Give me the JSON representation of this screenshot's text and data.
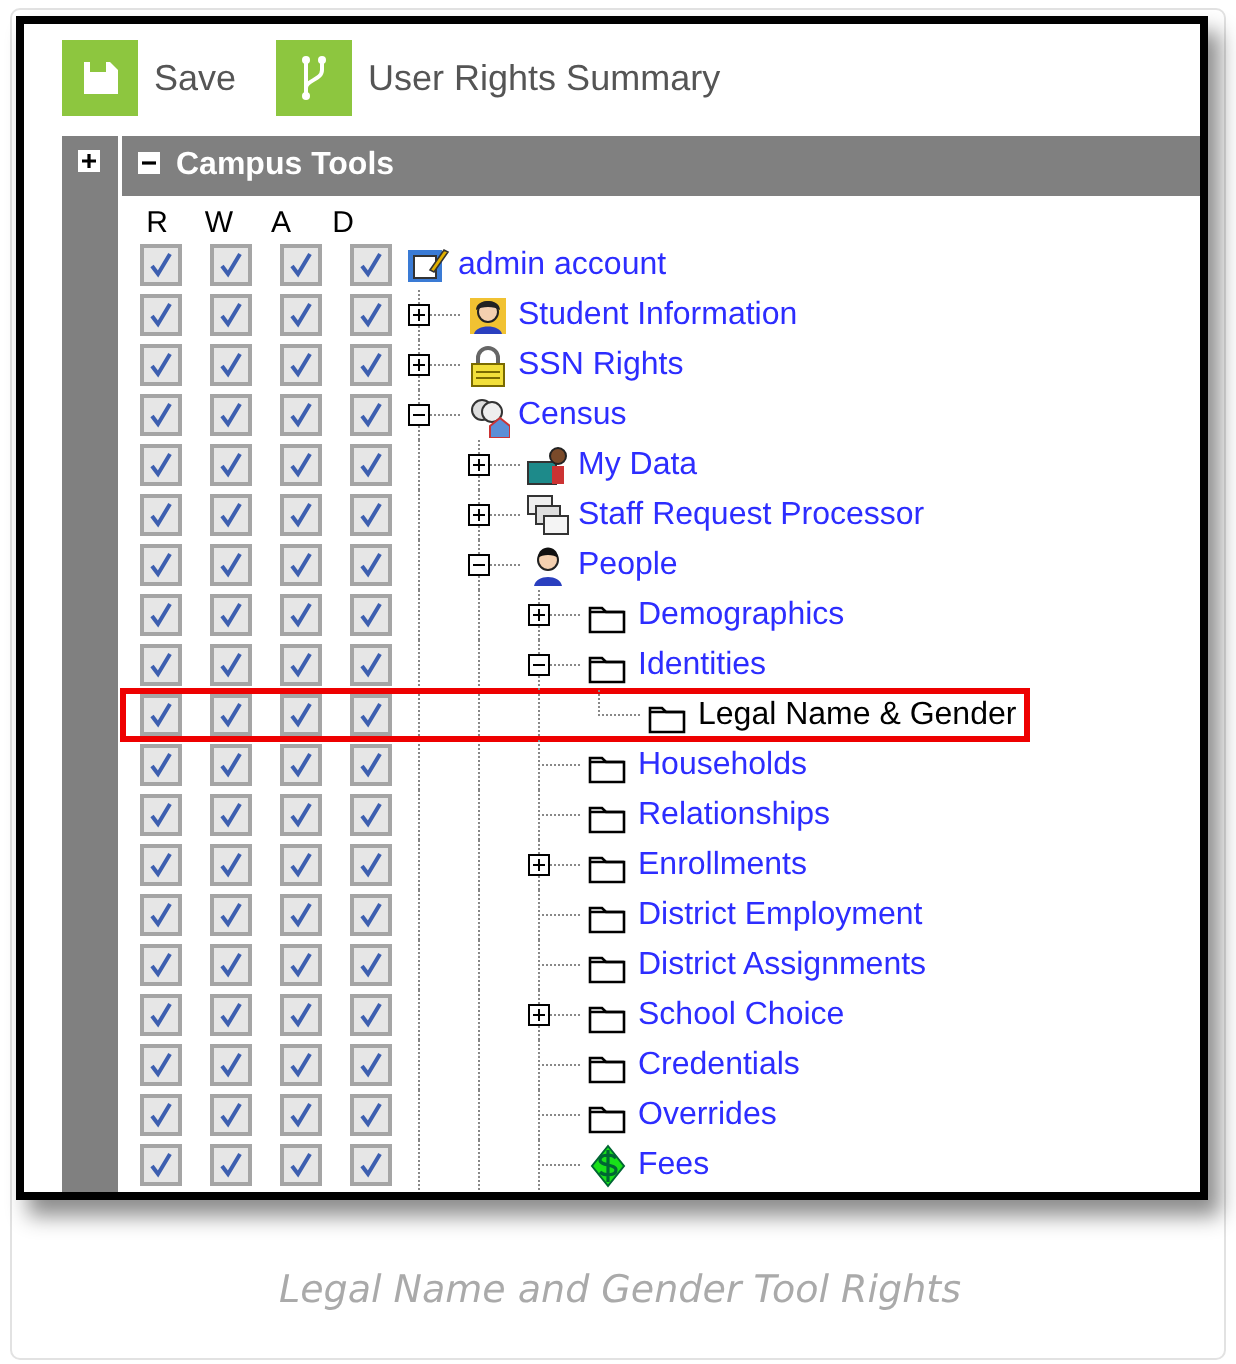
{
  "toolbar": {
    "buttons": [
      {
        "kind": "save",
        "label": "Save"
      },
      {
        "kind": "summary",
        "label": "User Rights Summary"
      }
    ]
  },
  "panel": {
    "title": "Campus Tools",
    "columns": [
      "R",
      "W",
      "A",
      "D"
    ],
    "tree": [
      {
        "label": "admin account",
        "kind": "account",
        "rights": [
          true,
          true,
          true,
          true
        ],
        "selected": false,
        "children": [
          {
            "label": "Student Information",
            "kind": "student",
            "expanded": false,
            "rights": [
              true,
              true,
              true,
              true
            ],
            "selected": false
          },
          {
            "label": "SSN Rights",
            "kind": "lock",
            "expanded": false,
            "rights": [
              true,
              true,
              true,
              true
            ],
            "selected": false
          },
          {
            "label": "Census",
            "kind": "census",
            "expanded": true,
            "rights": [
              true,
              true,
              true,
              true
            ],
            "selected": false,
            "children": [
              {
                "label": "My Data",
                "kind": "mydata",
                "expanded": false,
                "rights": [
                  true,
                  true,
                  true,
                  true
                ],
                "selected": false
              },
              {
                "label": "Staff Request Processor",
                "kind": "staff",
                "expanded": false,
                "rights": [
                  true,
                  true,
                  true,
                  true
                ],
                "selected": false
              },
              {
                "label": "People",
                "kind": "person",
                "expanded": true,
                "rights": [
                  true,
                  true,
                  true,
                  true
                ],
                "selected": false,
                "children": [
                  {
                    "label": "Demographics",
                    "kind": "folder",
                    "expanded": false,
                    "rights": [
                      true,
                      true,
                      true,
                      true
                    ],
                    "selected": false
                  },
                  {
                    "label": "Identities",
                    "kind": "folder",
                    "expanded": true,
                    "rights": [
                      true,
                      true,
                      true,
                      true
                    ],
                    "selected": false,
                    "children": [
                      {
                        "label": "Legal Name & Gender",
                        "kind": "folder",
                        "rights": [
                          true,
                          true,
                          true,
                          true
                        ],
                        "selected": true
                      }
                    ]
                  },
                  {
                    "label": "Households",
                    "kind": "folder",
                    "rights": [
                      true,
                      true,
                      true,
                      true
                    ],
                    "selected": false
                  },
                  {
                    "label": "Relationships",
                    "kind": "folder",
                    "rights": [
                      true,
                      true,
                      true,
                      true
                    ],
                    "selected": false
                  },
                  {
                    "label": "Enrollments",
                    "kind": "folder",
                    "expanded": false,
                    "rights": [
                      true,
                      true,
                      true,
                      true
                    ],
                    "selected": false
                  },
                  {
                    "label": "District Employment",
                    "kind": "folder",
                    "rights": [
                      true,
                      true,
                      true,
                      true
                    ],
                    "selected": false
                  },
                  {
                    "label": "District Assignments",
                    "kind": "folder",
                    "rights": [
                      true,
                      true,
                      true,
                      true
                    ],
                    "selected": false
                  },
                  {
                    "label": "School Choice",
                    "kind": "folder",
                    "expanded": false,
                    "rights": [
                      true,
                      true,
                      true,
                      true
                    ],
                    "selected": false
                  },
                  {
                    "label": "Credentials",
                    "kind": "folder",
                    "rights": [
                      true,
                      true,
                      true,
                      true
                    ],
                    "selected": false
                  },
                  {
                    "label": "Overrides",
                    "kind": "folder",
                    "rights": [
                      true,
                      true,
                      true,
                      true
                    ],
                    "selected": false
                  },
                  {
                    "label": "Fees",
                    "kind": "dollar",
                    "rights": [
                      true,
                      true,
                      true,
                      true
                    ],
                    "selected": false
                  }
                ]
              }
            ]
          }
        ]
      }
    ]
  },
  "caption": "Legal Name and Gender Tool Rights"
}
